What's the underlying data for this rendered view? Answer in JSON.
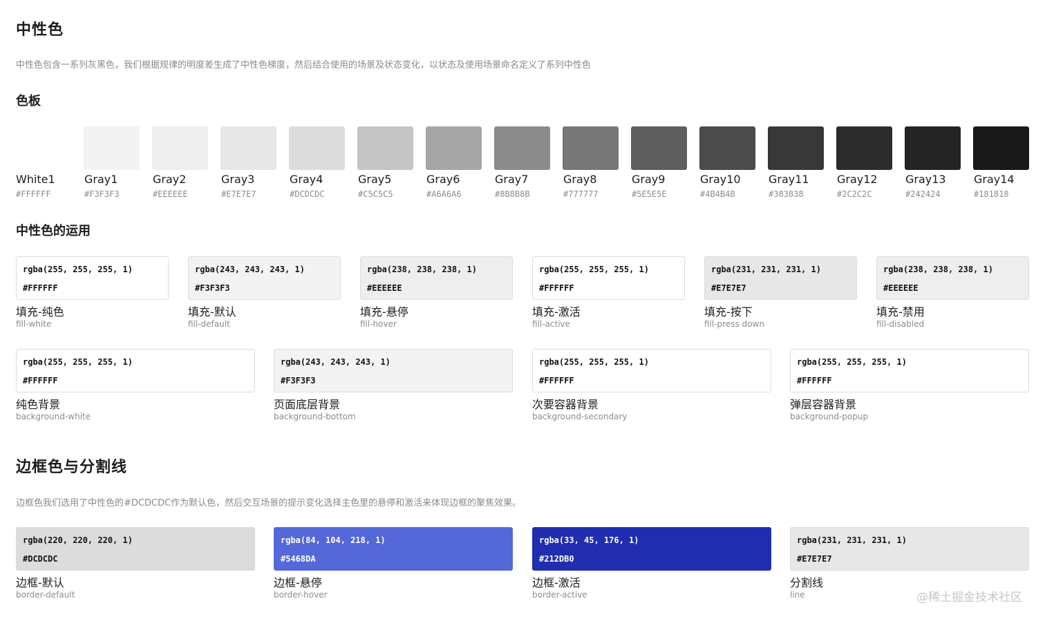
{
  "neutral": {
    "title": "中性色",
    "desc": "中性色包含一系列灰黑色，我们根据规律的明度差生成了中性色梯度，然后结合使用的场景及状态变化，以状态及使用场景命名定义了系列中性色"
  },
  "palette": {
    "title": "色板",
    "swatches": [
      {
        "name": "White1",
        "hex": "#FFFFFF",
        "color": "#FFFFFF"
      },
      {
        "name": "Gray1",
        "hex": "#F3F3F3",
        "color": "#F3F3F3"
      },
      {
        "name": "Gray2",
        "hex": "#EEEEEE",
        "color": "#EEEEEE"
      },
      {
        "name": "Gray3",
        "hex": "#E7E7E7",
        "color": "#E7E7E7"
      },
      {
        "name": "Gray4",
        "hex": "#DCDCDC",
        "color": "#DCDCDC"
      },
      {
        "name": "Gray5",
        "hex": "#C5C5C5",
        "color": "#C5C5C5"
      },
      {
        "name": "Gray6",
        "hex": "#A6A6A6",
        "color": "#A6A6A6"
      },
      {
        "name": "Gray7",
        "hex": "#8B8B8B",
        "color": "#8B8B8B"
      },
      {
        "name": "Gray8",
        "hex": "#777777",
        "color": "#777777"
      },
      {
        "name": "Gray9",
        "hex": "#5E5E5E",
        "color": "#5E5E5E"
      },
      {
        "name": "Gray10",
        "hex": "#4B4B4B",
        "color": "#4B4B4B"
      },
      {
        "name": "Gray11",
        "hex": "#383838",
        "color": "#383838"
      },
      {
        "name": "Gray12",
        "hex": "#2C2C2C",
        "color": "#2C2C2C"
      },
      {
        "name": "Gray13",
        "hex": "#242424",
        "color": "#242424"
      },
      {
        "name": "Gray14",
        "hex": "#181818",
        "color": "#181818"
      }
    ]
  },
  "usage": {
    "title": "中性色的运用",
    "fills": [
      {
        "rgba": "rgba(255, 255, 255, 1)",
        "hex": "#FFFFFF",
        "name": "填充-纯色",
        "token": "fill-white",
        "color": "#FFFFFF"
      },
      {
        "rgba": "rgba(243, 243, 243, 1)",
        "hex": "#F3F3F3",
        "name": "填充-默认",
        "token": "fill-default",
        "color": "#F3F3F3"
      },
      {
        "rgba": "rgba(238, 238, 238, 1)",
        "hex": "#EEEEEE",
        "name": "填充-悬停",
        "token": "fill-hover",
        "color": "#EEEEEE"
      },
      {
        "rgba": "rgba(255, 255, 255, 1)",
        "hex": "#FFFFFF",
        "name": "填充-激活",
        "token": "fill-active",
        "color": "#FFFFFF"
      },
      {
        "rgba": "rgba(231, 231, 231, 1)",
        "hex": "#E7E7E7",
        "name": "填充-按下",
        "token": "fill-press down",
        "color": "#E7E7E7"
      },
      {
        "rgba": "rgba(238, 238, 238, 1)",
        "hex": "#EEEEEE",
        "name": "填充-禁用",
        "token": "fill-disabled",
        "color": "#EEEEEE"
      }
    ],
    "backgrounds": [
      {
        "rgba": "rgba(255, 255, 255, 1)",
        "hex": "#FFFFFF",
        "name": "纯色背景",
        "token": "background-white",
        "color": "#FFFFFF"
      },
      {
        "rgba": "rgba(243, 243, 243, 1)",
        "hex": "#F3F3F3",
        "name": "页面底层背景",
        "token": "background-bottom",
        "color": "#F3F3F3"
      },
      {
        "rgba": "rgba(255, 255, 255, 1)",
        "hex": "#FFFFFF",
        "name": "次要容器背景",
        "token": "background-secondary",
        "color": "#FFFFFF"
      },
      {
        "rgba": "rgba(255, 255, 255, 1)",
        "hex": "#FFFFFF",
        "name": "弹层容器背景",
        "token": "background-popup",
        "color": "#FFFFFF"
      }
    ]
  },
  "border": {
    "title": "边框色与分割线",
    "desc": "边框色我们选用了中性色的#DCDCDC作为默认色，然后交互场景的提示变化选择主色里的悬停和激活来体现边框的聚焦效果。",
    "items": [
      {
        "rgba": "rgba(220, 220, 220, 1)",
        "hex": "#DCDCDC",
        "name": "边框-默认",
        "token": "border-default",
        "color": "#DCDCDC",
        "dark": false
      },
      {
        "rgba": "rgba(84, 104, 218, 1)",
        "hex": "#5468DA",
        "name": "边框-悬停",
        "token": "border-hover",
        "color": "#5468DA",
        "dark": true
      },
      {
        "rgba": "rgba(33, 45, 176, 1)",
        "hex": "#212DB0",
        "name": "边框-激活",
        "token": "border-active",
        "color": "#212DB0",
        "dark": true
      },
      {
        "rgba": "rgba(231, 231, 231, 1)",
        "hex": "#E7E7E7",
        "name": "分割线",
        "token": "line",
        "color": "#E7E7E7",
        "dark": false
      }
    ]
  },
  "watermark": "@稀土掘金技术社区"
}
